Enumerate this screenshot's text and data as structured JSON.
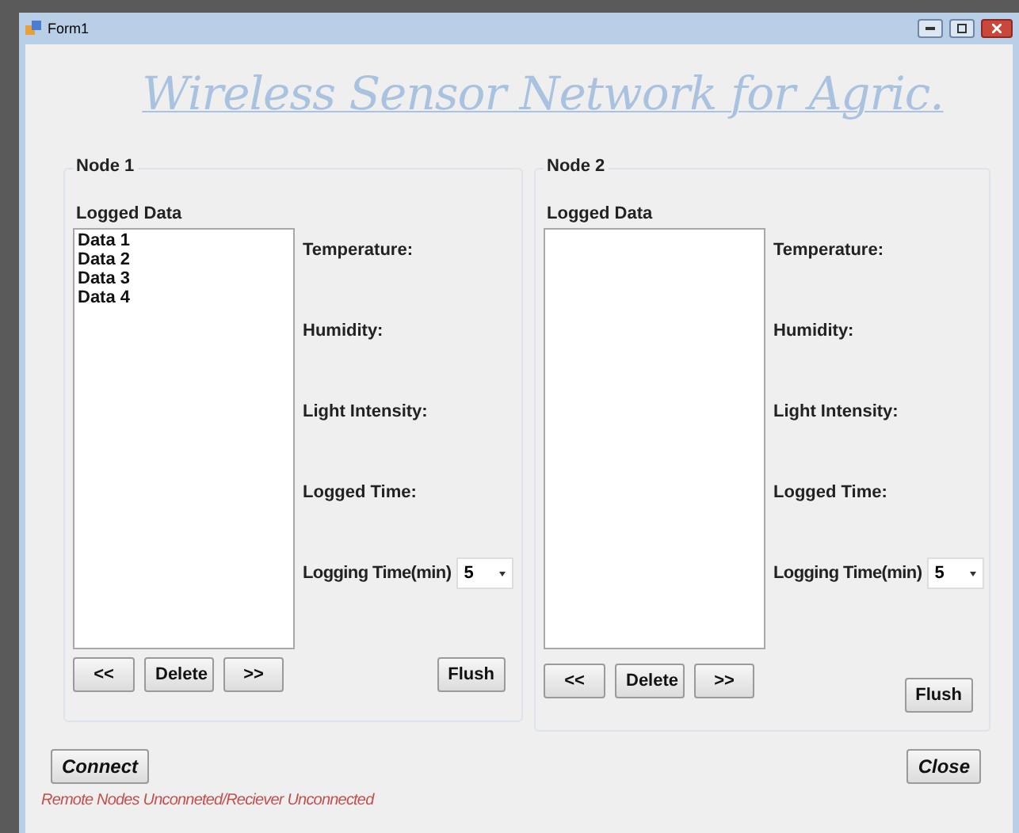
{
  "window": {
    "title": "Form1"
  },
  "heading": "Wireless Sensor Network for Agric.",
  "nodes": [
    {
      "title": "Node 1",
      "list_label": "Logged Data",
      "items": [
        "Data 1",
        "Data 2",
        "Data 3",
        "Data 4"
      ],
      "fields": [
        "Temperature:",
        "Humidity:",
        "Light Intensity:",
        "Logged Time:"
      ],
      "interval_label": "Logging Time(min)",
      "interval_value": "5",
      "buttons": [
        "<<",
        "Delete",
        ">>"
      ],
      "flush": "Flush"
    },
    {
      "title": "Node 2",
      "list_label": "Logged Data",
      "fields": [
        "Temperature:",
        "Humidity:",
        "Light Intensity:",
        "Logged Time:"
      ],
      "interval_label": "Logging Time(min)",
      "interval_value": "5",
      "buttons": [
        "<<",
        "Delete",
        ">>"
      ],
      "flush": "Flush"
    }
  ],
  "connect": "Connect",
  "close": "Close",
  "status": "Remote Nodes Unconneted/Reciever Unconnected"
}
